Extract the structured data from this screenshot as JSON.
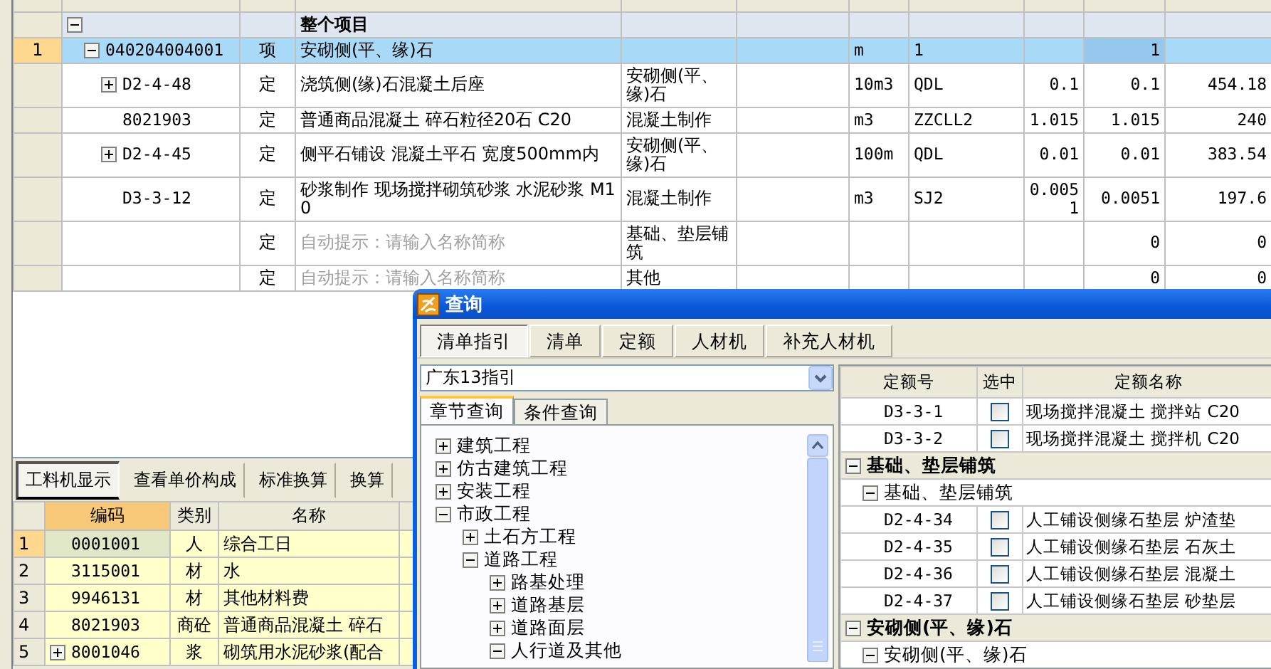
{
  "main_grid": {
    "rows": [
      {
        "kind": "summary",
        "name": "整个项目",
        "expanded": true,
        "children": [
          {
            "number": "1",
            "code": "040204004001",
            "type": "项",
            "name": "安砌侧(平、缘)石",
            "unit": "m",
            "expression": "1",
            "quantity": "1",
            "selected": true,
            "expanded": true,
            "children": [
              {
                "code": "D2-4-48",
                "type": "定",
                "name": "浇筑侧(缘)石混凝土后座",
                "content": "安砌侧(平、缘)石",
                "unit": "10m3",
                "expression": "QDL",
                "ratio": "0.1",
                "quantity": "0.1",
                "price": "454.18",
                "selected": false,
                "expanded": false
              },
              {
                "code": "8021903",
                "type": "定",
                "name": "普通商品混凝土 碎石粒径20石 C20",
                "content": "混凝土制作",
                "unit": "m3",
                "expression": "ZZCLL2",
                "ratio": "1.015",
                "quantity": "1.015",
                "price": "240",
                "selected": false
              },
              {
                "code": "D2-4-45",
                "type": "定",
                "name": "侧平石铺设 混凝土平石 宽度500mm内",
                "content": "安砌侧(平、缘)石",
                "unit": "100m",
                "expression": "QDL",
                "ratio": "0.01",
                "quantity": "0.01",
                "price": "383.54",
                "selected": false,
                "expanded": false
              },
              {
                "code": "D3-3-12",
                "type": "定",
                "name": "砂浆制作 现场搅拌砌筑砂浆 水泥砂浆 M10",
                "content": "混凝土制作",
                "unit": "m3",
                "expression": "SJ2",
                "ratio": "0.0051",
                "quantity": "0.0051",
                "price": "197.6",
                "selected": false
              },
              {
                "type": "定",
                "placeholder": "自动提示：请输入名称简称",
                "content": "基础、垫层铺筑",
                "quantity": "0",
                "price": "0",
                "selected": false
              },
              {
                "type": "定",
                "placeholder": "自动提示：请输入名称简称",
                "content": "其他",
                "quantity": "0",
                "price": "0",
                "selected": false
              }
            ]
          }
        ]
      }
    ]
  },
  "bottom_tabs": [
    {
      "label": "工料机显示",
      "selected": true
    },
    {
      "label": "查看单价构成",
      "selected": false
    },
    {
      "label": "标准换算",
      "selected": false
    },
    {
      "label": "换算",
      "selected": false
    }
  ],
  "resource_grid": {
    "columns": [
      "编码",
      "类别",
      "名称"
    ],
    "rows": [
      {
        "number": "1",
        "code": "0001001",
        "type": "人",
        "name": "综合工日",
        "selected": true
      },
      {
        "number": "2",
        "code": "3115001",
        "type": "材",
        "name": "水",
        "selected": false
      },
      {
        "number": "3",
        "code": "9946131",
        "type": "材",
        "name": "其他材料费",
        "selected": false
      },
      {
        "number": "4",
        "code": "8021903",
        "type": "商砼",
        "name": "普通商品混凝土 碎石",
        "selected": false
      },
      {
        "number": "5",
        "code": "8001046",
        "type": "浆",
        "name": "砌筑用水泥砂浆(配合",
        "selected": false,
        "expanded": false
      }
    ]
  },
  "dialog": {
    "title": "查询",
    "tabs": [
      {
        "label": "清单指引",
        "selected": true
      },
      {
        "label": "清单",
        "selected": false
      },
      {
        "label": "定额",
        "selected": false
      },
      {
        "label": "人材机",
        "selected": false
      },
      {
        "label": "补充人材机",
        "selected": false
      }
    ],
    "guide_select": {
      "value": "广东13指引"
    },
    "sub_tabs": [
      {
        "label": "章节查询",
        "selected": true
      },
      {
        "label": "条件查询",
        "selected": false
      }
    ],
    "tree": [
      {
        "label": "建筑工程",
        "expanded": false
      },
      {
        "label": "仿古建筑工程",
        "expanded": false
      },
      {
        "label": "安装工程",
        "expanded": false
      },
      {
        "label": "市政工程",
        "expanded": true,
        "children": [
          {
            "label": "土石方工程",
            "expanded": false
          },
          {
            "label": "道路工程",
            "expanded": true,
            "children": [
              {
                "label": "路基处理",
                "expanded": false
              },
              {
                "label": "道路基层",
                "expanded": false
              },
              {
                "label": "道路面层",
                "expanded": false
              },
              {
                "label": "人行道及其他",
                "expanded": true
              }
            ]
          }
        ]
      }
    ],
    "quota_table": {
      "columns": [
        "定额号",
        "选中",
        "定额名称"
      ],
      "rows": [
        {
          "kind": "item",
          "code": "D3-3-1",
          "checked": false,
          "name": "现场搅拌混凝土 搅拌站 C20"
        },
        {
          "kind": "item",
          "code": "D3-3-2",
          "checked": false,
          "name": "现场搅拌混凝土 搅拌机 C20"
        },
        {
          "kind": "group",
          "name": "基础、垫层铺筑",
          "expanded": true,
          "children": [
            {
              "kind": "subgroup",
              "name": "基础、垫层铺筑",
              "expanded": true,
              "children": [
                {
                  "kind": "item",
                  "code": "D2-4-34",
                  "checked": false,
                  "name": "人工铺设侧缘石垫层 炉渣垫"
                },
                {
                  "kind": "item",
                  "code": "D2-4-35",
                  "checked": false,
                  "name": "人工铺设侧缘石垫层 石灰土"
                },
                {
                  "kind": "item",
                  "code": "D2-4-36",
                  "checked": false,
                  "name": "人工铺设侧缘石垫层 混凝土"
                },
                {
                  "kind": "item",
                  "code": "D2-4-37",
                  "checked": false,
                  "name": "人工铺设侧缘石垫层 砂垫层"
                }
              ]
            }
          ]
        },
        {
          "kind": "group",
          "name": "安砌侧(平、缘)石",
          "expanded": true,
          "children": [
            {
              "kind": "subgroup",
              "name": "安砌侧(平、缘)石",
              "expanded": true
            }
          ]
        }
      ]
    }
  }
}
